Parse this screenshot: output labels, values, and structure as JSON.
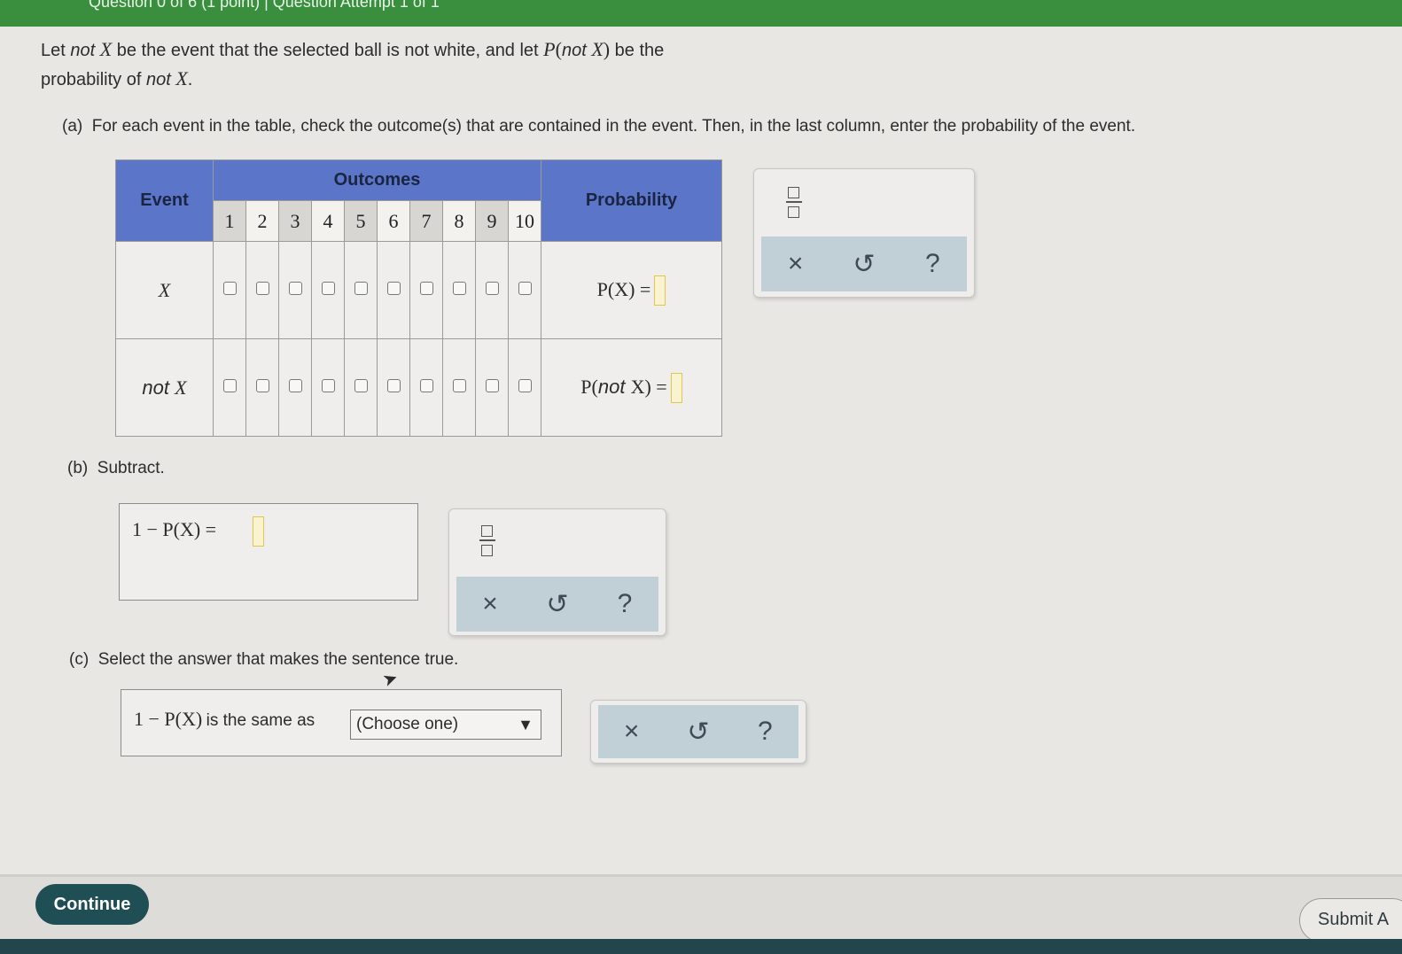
{
  "header": {
    "title": "Question 0 of 6 (1 point) | Question Attempt 1 of 1"
  },
  "intro": {
    "t1": "Let ",
    "not": "not",
    "x": "X",
    "t2": " be the event that the selected ball is not white, and let ",
    "p": "P",
    "lp": "(",
    "rp": ")",
    "t3": " be the",
    "t4": "probability of ",
    "period": "."
  },
  "part_a": {
    "label": "(a)",
    "text": "For each event in the table, check the outcome(s) that are contained in the event. Then, in the last column, enter the probability of the event.",
    "table": {
      "event_header": "Event",
      "outcomes_header": "Outcomes",
      "probability_header": "Probability",
      "outcome_numbers": [
        "1",
        "2",
        "3",
        "4",
        "5",
        "6",
        "7",
        "8",
        "9",
        "10"
      ],
      "rows": [
        {
          "event": "X",
          "prob_label": "P(X) ="
        },
        {
          "event_prefix": "not",
          "event": "X",
          "prob_label_pre": "P(",
          "prob_label_not": "not",
          "prob_label_post": "X) ="
        }
      ]
    }
  },
  "part_b": {
    "label": "(b)",
    "text": "Subtract.",
    "expression": "1 − P(X) ="
  },
  "part_c": {
    "label": "(c)",
    "text": "Select the answer that makes the sentence true.",
    "expression": "1 − P(X)",
    "middle": "is the same as",
    "select_value": "(Choose one)"
  },
  "toolbox": {
    "clear": "×",
    "undo": "↺",
    "help": "?"
  },
  "footer": {
    "continue": "Continue",
    "submit": "Submit A"
  }
}
